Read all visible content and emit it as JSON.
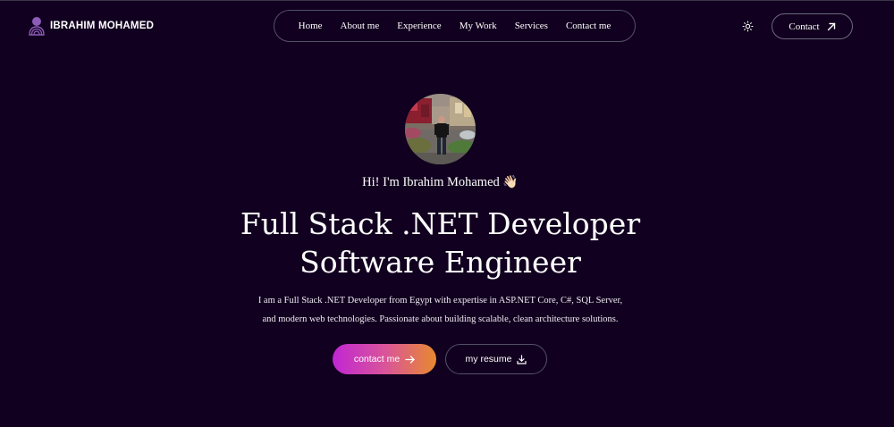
{
  "header": {
    "logo_text": "IBRAHIM MOHAMED",
    "nav": [
      {
        "label": "Home"
      },
      {
        "label": "About me"
      },
      {
        "label": "Experience"
      },
      {
        "label": "My Work"
      },
      {
        "label": "Services"
      },
      {
        "label": "Contact me"
      }
    ],
    "theme_toggle_icon": "sun-icon",
    "contact_label": "Contact",
    "contact_icon": "arrow-up-right-icon"
  },
  "hero": {
    "greeting": "Hi! I'm Ibrahim Mohamed",
    "greeting_emoji": "👋🏻",
    "headline_line1": "Full Stack .NET Developer",
    "headline_line2": "Software Engineer",
    "bio_line1": "I am a Full Stack .NET Developer from Egypt with expertise in ASP.NET Core, C#, SQL Server,",
    "bio_line2": "and modern web technologies. Passionate about building scalable, clean architecture solutions.",
    "primary_button": "contact me",
    "primary_icon": "arrow-right-icon",
    "secondary_button": "my resume",
    "secondary_icon": "download-icon"
  },
  "colors": {
    "background": "#11001f",
    "accent_gradient_start": "#c026d3",
    "accent_gradient_end": "#e8892f",
    "logo_accent": "#8b5cb8"
  }
}
